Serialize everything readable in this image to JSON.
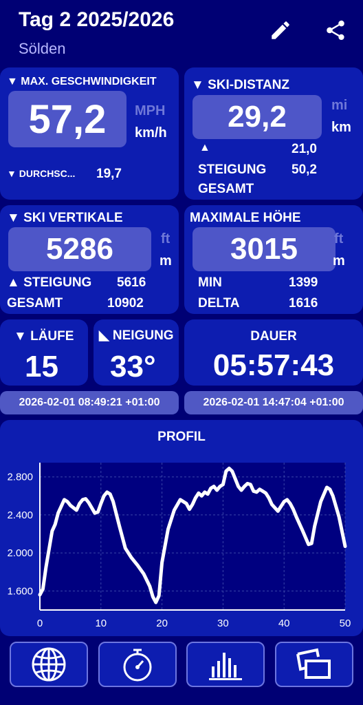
{
  "header": {
    "title": "Tag 2 2025/2026",
    "subtitle": "Sölden"
  },
  "max_speed": {
    "label": "▼ MAX. GESCHWINDIGKEIT",
    "value": "57,2",
    "unit_alt": "MPH",
    "unit": "km/h",
    "avg_label": "▼ DURCHSC...",
    "avg_value": "19,7"
  },
  "ski_distance": {
    "label": "▼ SKI-DISTANZ",
    "value": "29,2",
    "unit_alt": "mi",
    "unit": "km",
    "up_arrow": "▲",
    "up_value": "21,0",
    "climb_label": "STEIGUNG",
    "climb_value": "50,2",
    "total_label": "GESAMT"
  },
  "ski_vertical": {
    "label": "▼ SKI VERTIKALE",
    "value": "5286",
    "unit_alt": "ft",
    "unit": "m",
    "climb_label": "▲ STEIGUNG",
    "climb_value": "5616",
    "total_label": "GESAMT",
    "total_value": "10902"
  },
  "max_height": {
    "label": "MAXIMALE HÖHE",
    "value": "3015",
    "unit_alt": "ft",
    "unit": "m",
    "min_label": "MIN",
    "min_value": "1399",
    "delta_label": "DELTA",
    "delta_value": "1616"
  },
  "runs": {
    "label": "▼ LÄUFE",
    "value": "15"
  },
  "slope": {
    "label": "◣ NEIGUNG",
    "value": "33°"
  },
  "duration": {
    "label": "DAUER",
    "value": "05:57:43"
  },
  "times": {
    "start": "2026-02-01 08:49:21 +01:00",
    "end": "2026-02-01 14:47:04 +01:00"
  },
  "colors": {
    "background": "#000074",
    "card": "#0d1db0",
    "box": "#4e56c8",
    "chart_bg": "#000080"
  },
  "nav": [
    "globe-icon",
    "stopwatch-icon",
    "bar-chart-icon",
    "windows-icon"
  ],
  "chart_data": {
    "type": "line",
    "title": "PROFIL",
    "xlim": [
      0,
      50
    ],
    "ylim": [
      1400,
      2950
    ],
    "x_ticks": [
      "0",
      "10",
      "20",
      "30",
      "40",
      "50"
    ],
    "y_ticks": [
      "1.600",
      "2.000",
      "2.400",
      "2.800"
    ],
    "grid": true,
    "series": [
      {
        "x": [
          0,
          0.5,
          1,
          2,
          2.5,
          3,
          4,
          4.5,
          5,
          6,
          6.5,
          7,
          7.5,
          8,
          9,
          9.5,
          10,
          10.5,
          11,
          11.5,
          12,
          13,
          14,
          15,
          16,
          17,
          18,
          18.5,
          19,
          19.5,
          20,
          21,
          22,
          23,
          24,
          24.5,
          25,
          25.5,
          26,
          26.5,
          27,
          27.5,
          28,
          28.5,
          29,
          29.5,
          30,
          30.5,
          31,
          31.5,
          32,
          32.5,
          33,
          33.5,
          34,
          34.5,
          35,
          35.5,
          36,
          37,
          37.5,
          38,
          39,
          40,
          40.5,
          41,
          41.5,
          42,
          43,
          44,
          44.5,
          45,
          46,
          47,
          47.5,
          48,
          49,
          50
        ],
        "y": [
          1560,
          1620,
          1850,
          2230,
          2300,
          2420,
          2560,
          2540,
          2500,
          2450,
          2520,
          2560,
          2570,
          2530,
          2420,
          2430,
          2520,
          2600,
          2640,
          2620,
          2540,
          2290,
          2050,
          1950,
          1870,
          1780,
          1650,
          1540,
          1480,
          1550,
          1900,
          2250,
          2450,
          2560,
          2520,
          2460,
          2510,
          2580,
          2630,
          2600,
          2640,
          2620,
          2680,
          2700,
          2660,
          2700,
          2720,
          2860,
          2890,
          2860,
          2780,
          2700,
          2660,
          2700,
          2730,
          2720,
          2650,
          2640,
          2670,
          2630,
          2580,
          2510,
          2440,
          2540,
          2560,
          2520,
          2460,
          2380,
          2240,
          2090,
          2100,
          2280,
          2540,
          2690,
          2670,
          2600,
          2380,
          2070
        ]
      }
    ]
  }
}
